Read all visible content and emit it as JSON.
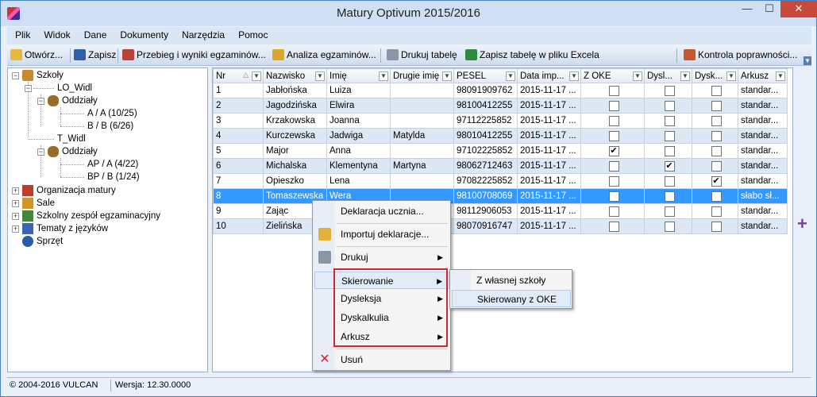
{
  "window": {
    "title": "Matury Optivum 2015/2016",
    "min": "—",
    "max": "☐",
    "close": "✕"
  },
  "menu": [
    "Plik",
    "Widok",
    "Dane",
    "Dokumenty",
    "Narzędzia",
    "Pomoc"
  ],
  "toolbar": {
    "open": "Otwórz...",
    "save": "Zapisz",
    "exams": "Przebieg i wyniki egzaminów...",
    "analysis": "Analiza egzaminów...",
    "print_table": "Drukuj tabelę",
    "save_excel": "Zapisz tabelę w pliku Excela",
    "check": "Kontrola poprawności..."
  },
  "tree": {
    "root": "Szkoły",
    "school1": "LO_Widl",
    "classes1": "Oddziały",
    "c1a": "A / A (10/25)",
    "c1b": "B / B (6/26)",
    "school2": "T_Widl",
    "classes2": "Oddziały",
    "c2a": "AP / A (4/22)",
    "c2b": "BP / B (1/24)",
    "org": "Organizacja matury",
    "rooms": "Sale",
    "team": "Szkolny zespół egzaminacyjny",
    "topics": "Tematy z języków",
    "equipment": "Sprzęt"
  },
  "grid": {
    "headers": [
      "Nr",
      "Nazwisko",
      "Imię",
      "Drugie imię",
      "PESEL",
      "Data imp...",
      "Z OKE",
      "Dysl...",
      "Dysk...",
      "Arkusz"
    ],
    "rows": [
      {
        "nr": "1",
        "nazwisko": "Jabłońska",
        "imie": "Luiza",
        "drugie": "",
        "pesel": "98091909762",
        "data": "2015-11-17 ...",
        "oke": "",
        "dysl": "",
        "dysk": "",
        "arkusz": "standar..."
      },
      {
        "nr": "2",
        "nazwisko": "Jagodzińska",
        "imie": "Elwira",
        "drugie": "",
        "pesel": "98100412255",
        "data": "2015-11-17 ...",
        "oke": "",
        "dysl": "",
        "dysk": "",
        "arkusz": "standar..."
      },
      {
        "nr": "3",
        "nazwisko": "Krzakowska",
        "imie": "Joanna",
        "drugie": "",
        "pesel": "97112225852",
        "data": "2015-11-17 ...",
        "oke": "",
        "dysl": "",
        "dysk": "",
        "arkusz": "standar..."
      },
      {
        "nr": "4",
        "nazwisko": "Kurczewska",
        "imie": "Jadwiga",
        "drugie": "Matylda",
        "pesel": "98010412255",
        "data": "2015-11-17 ...",
        "oke": "",
        "dysl": "",
        "dysk": "",
        "arkusz": "standar..."
      },
      {
        "nr": "5",
        "nazwisko": "Major",
        "imie": "Anna",
        "drugie": "",
        "pesel": "97102225852",
        "data": "2015-11-17 ...",
        "oke": "✔",
        "dysl": "",
        "dysk": "",
        "arkusz": "standar..."
      },
      {
        "nr": "6",
        "nazwisko": "Michalska",
        "imie": "Klementyna",
        "drugie": "Martyna",
        "pesel": "98062712463",
        "data": "2015-11-17 ...",
        "oke": "",
        "dysl": "✔",
        "dysk": "",
        "arkusz": "standar..."
      },
      {
        "nr": "7",
        "nazwisko": "Opieszko",
        "imie": "Lena",
        "drugie": "",
        "pesel": "97082225852",
        "data": "2015-11-17 ...",
        "oke": "",
        "dysl": "",
        "dysk": "✔",
        "arkusz": "standar..."
      },
      {
        "nr": "8",
        "nazwisko": "Tomaszewska",
        "imie": "Wera",
        "drugie": "",
        "pesel": "98100708069",
        "data": "2015-11-17 ...",
        "oke": "",
        "dysl": "",
        "dysk": "",
        "arkusz": "słabo sł..."
      },
      {
        "nr": "9",
        "nazwisko": "Zając",
        "imie": "Ewa",
        "drugie": "",
        "pesel": "98112906053",
        "data": "2015-11-17 ...",
        "oke": "",
        "dysl": "",
        "dysk": "",
        "arkusz": "standar..."
      },
      {
        "nr": "10",
        "nazwisko": "Zielińska",
        "imie": "",
        "drugie": "",
        "pesel": "98070916747",
        "data": "2015-11-17 ...",
        "oke": "",
        "dysl": "",
        "dysk": "",
        "arkusz": "standar..."
      }
    ]
  },
  "context_menu": {
    "declaration": "Deklaracja ucznia...",
    "import": "Importuj deklaracje...",
    "print": "Drukuj",
    "referral": "Skierowanie",
    "dyslexia": "Dysleksja",
    "dyscalculia": "Dyskalkulia",
    "sheet": "Arkusz",
    "delete": "Usuń"
  },
  "submenu": {
    "own_school": "Z własnej szkoły",
    "from_oke": "Skierowany z OKE"
  },
  "status": {
    "copyright": "© 2004-2016 VULCAN",
    "version": "Wersja: 12.30.0000"
  },
  "colors": {
    "selection": "#3399ff",
    "close": "#c7493a",
    "highlight_box": "#d0262f"
  }
}
